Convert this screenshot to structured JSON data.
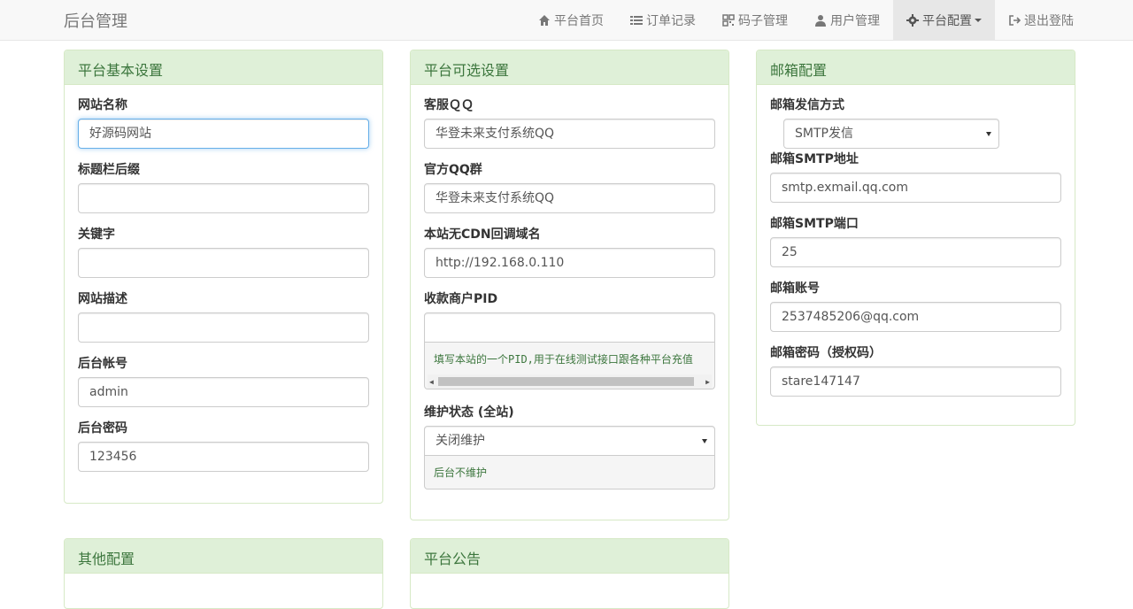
{
  "brand": "后台管理",
  "nav": [
    {
      "label": "平台首页",
      "icon": "home-icon"
    },
    {
      "label": "订单记录",
      "icon": "list-icon"
    },
    {
      "label": "码子管理",
      "icon": "qrcode-icon"
    },
    {
      "label": "用户管理",
      "icon": "user-icon"
    },
    {
      "label": "平台配置",
      "icon": "gear-icon"
    },
    {
      "label": "退出登陆",
      "icon": "logout-icon"
    }
  ],
  "basic": {
    "title": "平台基本设置",
    "site_name": {
      "label": "网站名称",
      "value": "好源码网站"
    },
    "title_suffix": {
      "label": "标题栏后缀",
      "value": ""
    },
    "keywords": {
      "label": "关键字",
      "value": ""
    },
    "description": {
      "label": "网站描述",
      "value": ""
    },
    "admin_user": {
      "label": "后台帐号",
      "value": "admin"
    },
    "admin_pass": {
      "label": "后台密码",
      "value": "123456"
    }
  },
  "optional": {
    "title": "平台可选设置",
    "service_qq": {
      "label": "客服ＱＱ",
      "value": "华登未来支付系统QQ"
    },
    "qq_group": {
      "label": "官方QQ群",
      "value": "华登未来支付系统QQ"
    },
    "callback_domain": {
      "label": "本站无CDN回调域名",
      "value": "http://192.168.0.110"
    },
    "merchant_pid": {
      "label": "收款商户PID",
      "value": "",
      "help": "填写本站的一个PID,用于在线测试接口跟各种平台充值"
    },
    "maintenance": {
      "label": "维护状态 (全站)",
      "value": "关闭维护",
      "help": "后台不维护"
    }
  },
  "mail": {
    "title": "邮箱配置",
    "method": {
      "label": "邮箱发信方式",
      "value": "SMTP发信"
    },
    "smtp_host": {
      "label": "邮箱SMTP地址",
      "value": "smtp.exmail.qq.com"
    },
    "smtp_port": {
      "label": "邮箱SMTP端口",
      "value": "25"
    },
    "account": {
      "label": "邮箱账号",
      "value": "2537485206@qq.com"
    },
    "password": {
      "label": "邮箱密码（授权码）",
      "value": "stare147147"
    }
  },
  "other": {
    "title": "其他配置"
  },
  "notice": {
    "title": "平台公告"
  },
  "colors": {
    "panel_heading_bg": "#dff0d8",
    "panel_heading_text": "#3c763d",
    "navbar_bg": "#f8f8f8"
  }
}
